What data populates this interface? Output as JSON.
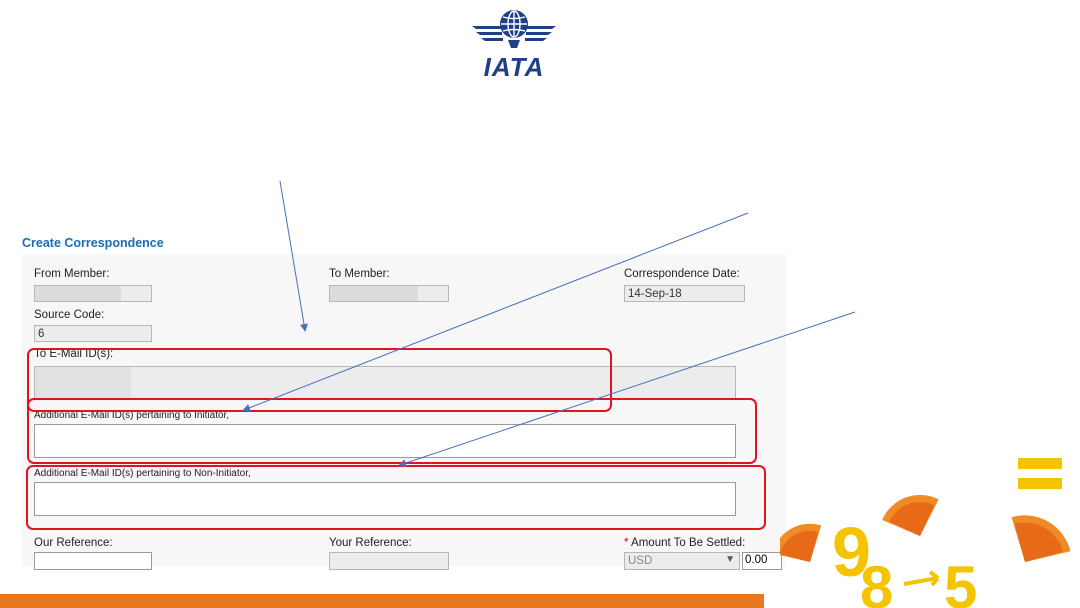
{
  "brand": {
    "logo_text": "IATA",
    "accent": "#1f3f86",
    "bar_color": "#e87722",
    "highlight": "#e0141c"
  },
  "form": {
    "title": "Create Correspondence",
    "from_member": {
      "label": "From Member:",
      "value": ""
    },
    "to_member": {
      "label": "To Member:",
      "value": ""
    },
    "correspondence_date": {
      "label": "Correspondence Date:",
      "value": "14-Sep-18"
    },
    "source_code": {
      "label": "Source Code:",
      "value": "6"
    },
    "to_email": {
      "label": "To E-Mail ID(s):",
      "value": ""
    },
    "additional_initiator": {
      "label": "Additional E-Mail ID(s) pertaining to Initiator,",
      "value": ""
    },
    "additional_non_initiator": {
      "label": "Additional E-Mail ID(s) pertaining to Non-Initiator,",
      "value": ""
    },
    "our_reference": {
      "label": "Our Reference:",
      "value": ""
    },
    "your_reference": {
      "label": "Your Reference:",
      "value": ""
    },
    "amount": {
      "required_mark": "*",
      "label": "Amount To Be Settled:",
      "currency": "USD",
      "value": "0.00"
    }
  },
  "decoration": {
    "glyphs": [
      "9",
      "8",
      "5",
      "="
    ]
  }
}
